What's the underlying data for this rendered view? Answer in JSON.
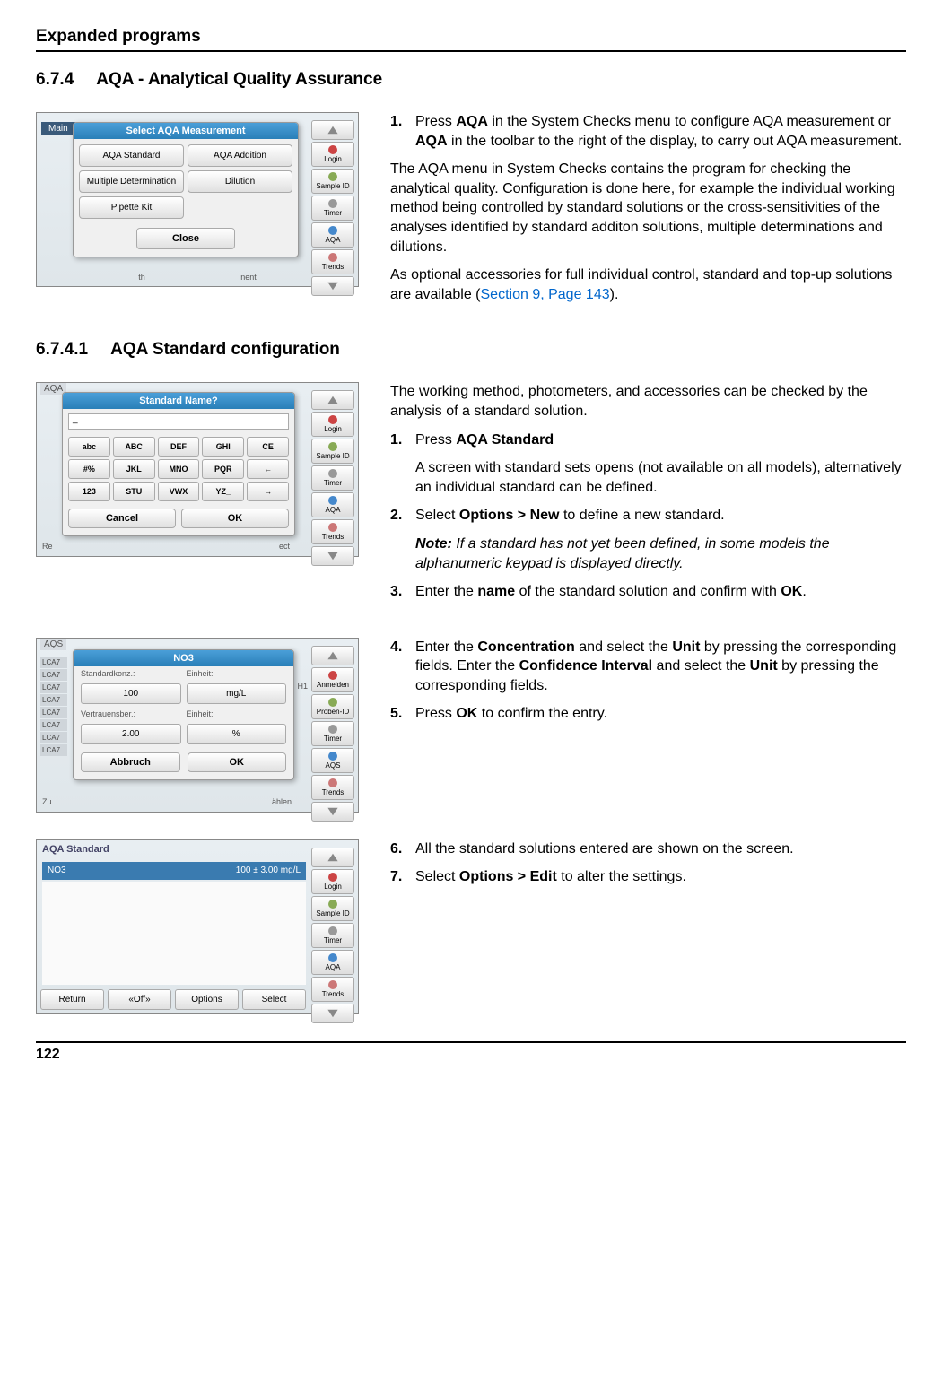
{
  "header": "Expanded programs",
  "page_number": "122",
  "section": {
    "num": "6.7.4",
    "title": "AQA - Analytical Quality Assurance"
  },
  "subsection": {
    "num": "6.7.4.1",
    "title": "AQA Standard configuration"
  },
  "block1": {
    "step1_num": "1.",
    "step1": "Press AQA in the System Checks menu to configure AQA measurement or AQA in the toolbar to the right of the display, to carry out AQA measurement.",
    "para1": "The AQA menu in System Checks contains the program for checking the analytical quality. Configuration is done here, for example the individual working method being controlled by standard solutions or the cross-sensitivities of the analyses identified by standard additon solutions, multiple determinations and dilutions.",
    "para2_a": " As optional accessories for full individual control, standard and top-up solutions are available (",
    "para2_link": "Section 9, Page 143",
    "para2_b": ")."
  },
  "block2": {
    "intro": "The working method, photometers, and accessories can be checked by the analysis of a standard solution.",
    "step1_num": "1.",
    "step1": "Press AQA Standard",
    "step1_sub": "A screen with standard sets opens (not available on all models), alternatively an individual standard can be defined.",
    "step2_num": "2.",
    "step2": " Select Options > New to define a new standard.",
    "note_label": "Note:",
    "note": " If a standard has not yet been defined, in some models the alphanumeric keypad is displayed directly.",
    "step3_num": "3.",
    "step3": "Enter the name of the standard solution and confirm with OK."
  },
  "block3": {
    "step4_num": "4.",
    "step4": "Enter the Concentration and select the Unit by pressing the corresponding fields. Enter the Confidence Interval and select the Unit by pressing the corresponding fields.",
    "step5_num": "5.",
    "step5": "Press OK to confirm the entry."
  },
  "block4": {
    "step6_num": "6.",
    "step6": "All the standard solutions entered are shown on the screen.",
    "step7_num": "7.",
    "step7": "Select Options > Edit to alter the settings."
  },
  "sidebar": {
    "login": "Login",
    "sample_id": "Sample ID",
    "timer": "Timer",
    "aqa": "AQA",
    "trends": "Trends",
    "anmelden": "Anmelden",
    "proben_id": "Proben-ID",
    "aqs": "AQS"
  },
  "ss1": {
    "main_label": "Main",
    "title": "Select AQA Measurement",
    "btn_std": "AQA Standard",
    "btn_add": "AQA Addition",
    "btn_mult": "Multiple Determination",
    "btn_dil": "Dilution",
    "btn_pip": "Pipette Kit",
    "close": "Close",
    "th": "th",
    "nent": "nent"
  },
  "ss2": {
    "hdr": "AQA",
    "title": "Standard Name?",
    "cursor": "_",
    "keys": [
      "abc",
      "ABC",
      "DEF",
      "GHI",
      "CE",
      "#%",
      "JKL",
      "MNO",
      "PQR",
      "←",
      "123",
      "STU",
      "VWX",
      "YZ_",
      "→"
    ],
    "cancel": "Cancel",
    "ok": "OK",
    "re": "Re",
    "ect": "ect"
  },
  "ss3": {
    "hdr": "AQS",
    "title": "NO3",
    "lbl_conc": "Standardkonz.:",
    "lbl_unit": "Einheit:",
    "val_conc": "100",
    "val_unit": "mg/L",
    "lbl_conf": "Vertrauensber.:",
    "lbl_unit2": "Einheit:",
    "val_conf": "2.00",
    "val_unit2": "%",
    "cancel": "Abbruch",
    "ok": "OK",
    "list_item": "LCA7",
    "zu": "Zu",
    "h1": "H1",
    "ahlen": "ählen"
  },
  "ss4": {
    "title": "AQA Standard",
    "row_name": "NO3",
    "row_val": "100 ±  3.00 mg/L",
    "return": "Return",
    "off": "«Off»",
    "options": "Options",
    "select": "Select"
  }
}
